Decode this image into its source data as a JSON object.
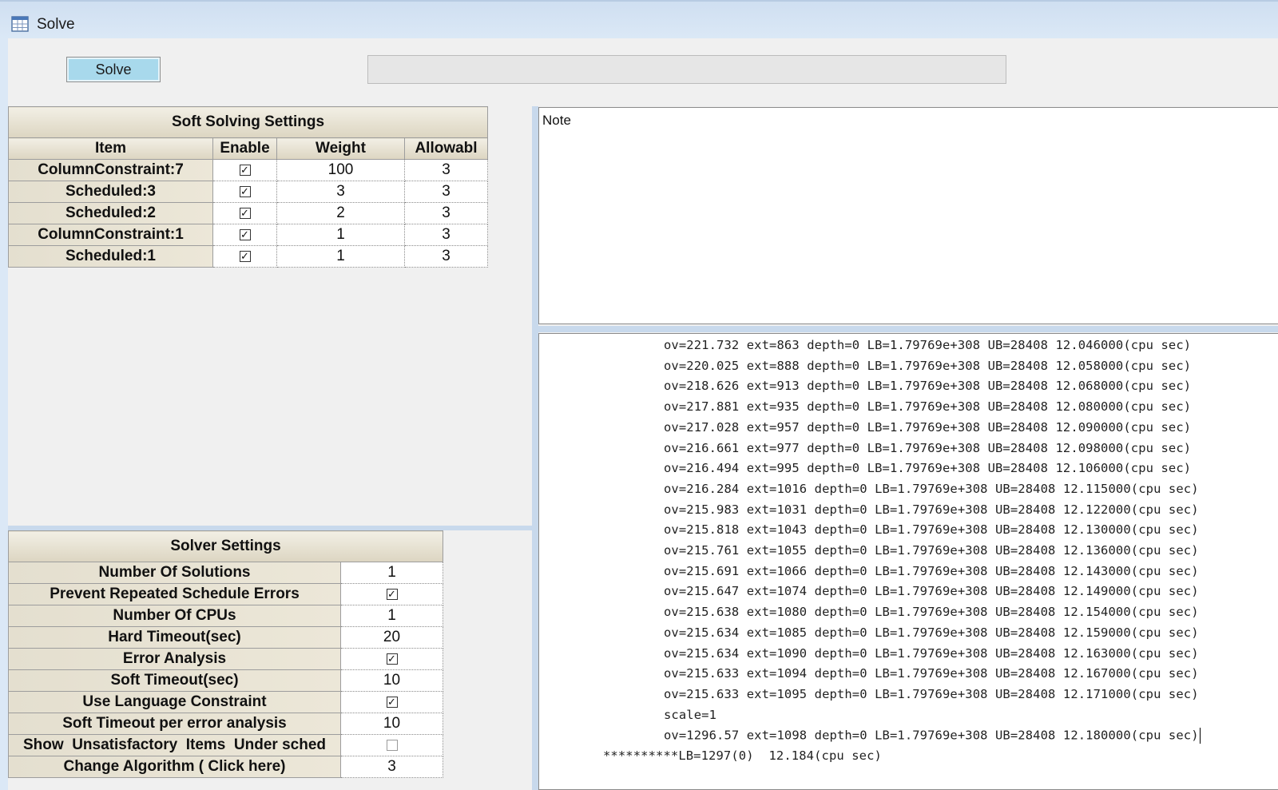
{
  "window": {
    "title": "Solve"
  },
  "toolbar": {
    "solve_label": "Solve",
    "progress": 0
  },
  "soft_settings": {
    "title": "Soft Solving Settings",
    "columns": [
      "Item",
      "Enable",
      "Weight",
      "Allowabl"
    ],
    "rows": [
      {
        "item": "ColumnConstraint:7",
        "enabled": true,
        "weight": "100",
        "allowable": "3"
      },
      {
        "item": "Scheduled:3",
        "enabled": true,
        "weight": "3",
        "allowable": "3"
      },
      {
        "item": "Scheduled:2",
        "enabled": true,
        "weight": "2",
        "allowable": "3"
      },
      {
        "item": "ColumnConstraint:1",
        "enabled": true,
        "weight": "1",
        "allowable": "3"
      },
      {
        "item": "Scheduled:1",
        "enabled": true,
        "weight": "1",
        "allowable": "3"
      }
    ]
  },
  "solver_settings": {
    "title": "Solver Settings",
    "rows": [
      {
        "label": "Number Of Solutions",
        "type": "text",
        "value": "1"
      },
      {
        "label": "Prevent Repeated Schedule Errors",
        "type": "check",
        "checked": true
      },
      {
        "label": "Number Of CPUs",
        "type": "text",
        "value": "1"
      },
      {
        "label": "Hard Timeout(sec)",
        "type": "text",
        "value": "20"
      },
      {
        "label": "Error Analysis",
        "type": "check",
        "checked": true
      },
      {
        "label": "Soft Timeout(sec)",
        "type": "text",
        "value": "10"
      },
      {
        "label": "Use Language Constraint",
        "type": "check",
        "checked": true
      },
      {
        "label": "Soft Timeout per error analysis",
        "type": "text",
        "value": "10"
      },
      {
        "label": "Show  Unsatisfactory  Items  Under sched",
        "type": "check",
        "checked": false
      },
      {
        "label": "Change Algorithm ( Click here)",
        "type": "text",
        "value": "3"
      }
    ]
  },
  "note": {
    "label": "Note"
  },
  "log": {
    "lines": [
      "ov=221.732 ext=863 depth=0 LB=1.79769e+308 UB=28408 12.046000(cpu sec)",
      "ov=220.025 ext=888 depth=0 LB=1.79769e+308 UB=28408 12.058000(cpu sec)",
      "ov=218.626 ext=913 depth=0 LB=1.79769e+308 UB=28408 12.068000(cpu sec)",
      "ov=217.881 ext=935 depth=0 LB=1.79769e+308 UB=28408 12.080000(cpu sec)",
      "ov=217.028 ext=957 depth=0 LB=1.79769e+308 UB=28408 12.090000(cpu sec)",
      "ov=216.661 ext=977 depth=0 LB=1.79769e+308 UB=28408 12.098000(cpu sec)",
      "ov=216.494 ext=995 depth=0 LB=1.79769e+308 UB=28408 12.106000(cpu sec)",
      "ov=216.284 ext=1016 depth=0 LB=1.79769e+308 UB=28408 12.115000(cpu sec)",
      "ov=215.983 ext=1031 depth=0 LB=1.79769e+308 UB=28408 12.122000(cpu sec)",
      "ov=215.818 ext=1043 depth=0 LB=1.79769e+308 UB=28408 12.130000(cpu sec)",
      "ov=215.761 ext=1055 depth=0 LB=1.79769e+308 UB=28408 12.136000(cpu sec)",
      "ov=215.691 ext=1066 depth=0 LB=1.79769e+308 UB=28408 12.143000(cpu sec)",
      "ov=215.647 ext=1074 depth=0 LB=1.79769e+308 UB=28408 12.149000(cpu sec)",
      "ov=215.638 ext=1080 depth=0 LB=1.79769e+308 UB=28408 12.154000(cpu sec)",
      "ov=215.634 ext=1085 depth=0 LB=1.79769e+308 UB=28408 12.159000(cpu sec)",
      "ov=215.634 ext=1090 depth=0 LB=1.79769e+308 UB=28408 12.163000(cpu sec)",
      "ov=215.633 ext=1094 depth=0 LB=1.79769e+308 UB=28408 12.167000(cpu sec)",
      "ov=215.633 ext=1095 depth=0 LB=1.79769e+308 UB=28408 12.171000(cpu sec)",
      "scale=1",
      "ov=1296.57 ext=1098 depth=0 LB=1.79769e+308 UB=28408 12.180000(cpu sec)"
    ],
    "summary": "**********LB=1297(0)  12.184(cpu sec)"
  }
}
